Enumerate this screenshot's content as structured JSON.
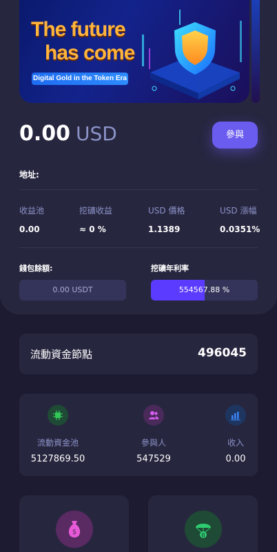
{
  "banner": {
    "title_line1": "The future",
    "title_line2": "has come",
    "tagline": "Digital Gold in the Token Era"
  },
  "balance": {
    "amount": "0.00",
    "currency": "USD"
  },
  "join_button_label": "參與",
  "address_label": "地址:",
  "stats": [
    {
      "label": "收益池",
      "value": "0.00"
    },
    {
      "label": "挖礦收益",
      "value": "≈ 0 %"
    },
    {
      "label": "USD 價格",
      "value": "1.1389"
    },
    {
      "label": "USD 漲幅",
      "value": "0.0351%"
    }
  ],
  "wallet": {
    "label": "錢包餘額:",
    "value": "0.00 USDT"
  },
  "mining_rate": {
    "label": "挖礦年利率",
    "value": "554567.88 %",
    "fill_fraction": 0.5
  },
  "liquidity_node": {
    "label": "流動資金節點",
    "value": "496045"
  },
  "pool": [
    {
      "icon": "chip-icon",
      "label": "流動資金池",
      "value": "5127869.50",
      "color": "#34c759"
    },
    {
      "icon": "users-icon",
      "label": "參與人",
      "value": "547529",
      "color": "#d65cf0"
    },
    {
      "icon": "bar-chart-icon",
      "label": "收入",
      "value": "0.00",
      "color": "#3b82f6"
    }
  ],
  "tiles": [
    {
      "icon": "money-bag-icon",
      "color": "#e85ad8"
    },
    {
      "icon": "parachute-coin-icon",
      "color": "#2ecc71"
    }
  ],
  "colors": {
    "background": "#1c1b31",
    "card": "#27263f",
    "accent": "#6b5cf0",
    "muted_text": "#8c93c7"
  }
}
